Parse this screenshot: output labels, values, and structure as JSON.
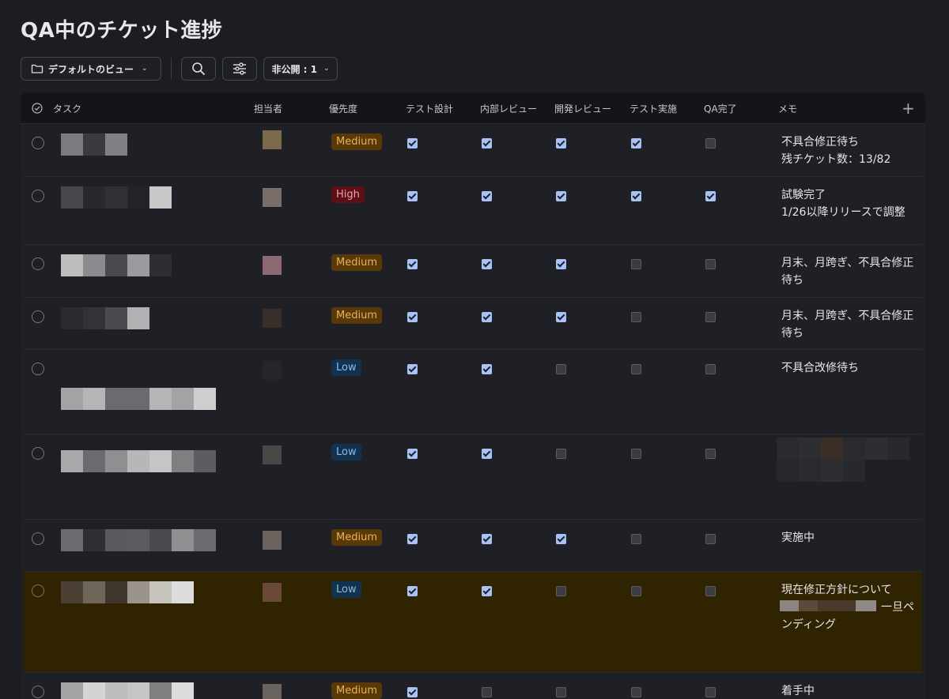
{
  "page": {
    "title": "QA中のチケット進捗"
  },
  "toolbar": {
    "view_label": "デフォルトのビュー",
    "private_label": "非公開 : 1"
  },
  "table": {
    "headers": {
      "task": "タスク",
      "assignee": "担当者",
      "priority": "優先度",
      "test_design": "テスト設計",
      "internal_review": "内部レビュー",
      "dev_review": "開発レビュー",
      "test_exec": "テスト実施",
      "qa_done": "QA完了",
      "memo": "メモ"
    },
    "rows": [
      {
        "priority": "Medium",
        "checks": [
          true,
          true,
          true,
          true,
          false
        ],
        "memo": [
          "不具合修正待ち",
          "残チケット数：13/82"
        ]
      },
      {
        "priority": "High",
        "checks": [
          true,
          true,
          true,
          true,
          true
        ],
        "memo": [
          "試験完了",
          "1/26以降リリースで調整"
        ]
      },
      {
        "priority": "Medium",
        "checks": [
          true,
          true,
          true,
          false,
          false
        ],
        "memo": [
          "月末、月跨ぎ、不具合修正",
          "待ち"
        ]
      },
      {
        "priority": "Medium",
        "checks": [
          true,
          true,
          true,
          false,
          false
        ],
        "memo": [
          "月末、月跨ぎ、不具合修正",
          "待ち"
        ]
      },
      {
        "priority": "Low",
        "checks": [
          true,
          true,
          false,
          false,
          false
        ],
        "memo": [
          "不具合改修待ち"
        ]
      },
      {
        "priority": "Low",
        "checks": [
          true,
          true,
          false,
          false,
          false
        ],
        "memo": []
      },
      {
        "priority": "Medium",
        "checks": [
          true,
          true,
          true,
          false,
          false
        ],
        "memo": [
          "実施中"
        ]
      },
      {
        "priority": "Low",
        "checks": [
          true,
          true,
          false,
          false,
          false
        ],
        "memo": [
          "現在修正方針について",
          "一旦ペ",
          "ンディング"
        ]
      },
      {
        "priority": "Medium",
        "checks": [
          true,
          false,
          false,
          false,
          false
        ],
        "memo": [
          "着手中"
        ]
      }
    ]
  },
  "colors": {
    "background": "#1b1d22",
    "highlight_row": "#2f2302",
    "checkbox_on": "#a8c2f5"
  },
  "icons": [
    "folder-icon",
    "chevron-down-icon",
    "search-icon",
    "sliders-icon",
    "check-circle-icon",
    "plus-icon",
    "circle-icon"
  ]
}
